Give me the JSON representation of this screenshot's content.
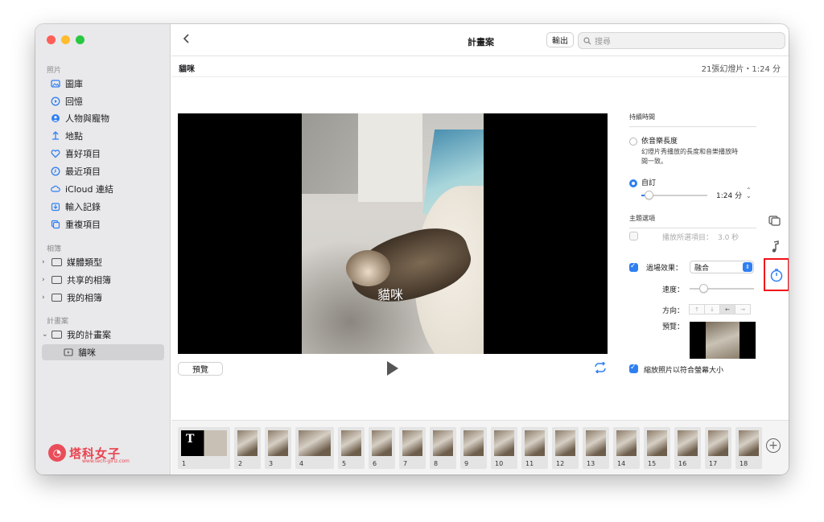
{
  "window": {
    "traffic_colors": [
      "#fe5f57",
      "#febc2e",
      "#28c840"
    ]
  },
  "sidebar": {
    "sections": [
      {
        "title": "照片",
        "items": [
          {
            "label": "圖庫",
            "icon": "photo-library-icon"
          },
          {
            "label": "回憶",
            "icon": "memories-icon"
          },
          {
            "label": "人物與寵物",
            "icon": "people-icon"
          },
          {
            "label": "地點",
            "icon": "places-icon"
          },
          {
            "label": "喜好項目",
            "icon": "heart-icon"
          },
          {
            "label": "最近項目",
            "icon": "clock-icon"
          },
          {
            "label": "iCloud 連結",
            "icon": "cloud-link-icon"
          },
          {
            "label": "輸入記錄",
            "icon": "import-icon"
          },
          {
            "label": "重複項目",
            "icon": "duplicates-icon"
          }
        ]
      },
      {
        "title": "相簿",
        "items": [
          {
            "label": "媒體類型"
          },
          {
            "label": "共享的相簿"
          },
          {
            "label": "我的相簿"
          }
        ]
      },
      {
        "title": "計畫案",
        "items": [
          {
            "label": "我的計畫案"
          },
          {
            "label": "貓咪"
          }
        ]
      }
    ],
    "logo": {
      "text": "塔科女子",
      "sub": "www.tech-girlz.com"
    }
  },
  "toolbar": {
    "title": "計畫案",
    "export_label": "輸出",
    "search_placeholder": "搜尋"
  },
  "project": {
    "name": "貓咪",
    "info": "21張幻燈片・1:24 分"
  },
  "viewer": {
    "caption": "貓咪",
    "preview_label": "預覽"
  },
  "inspector": {
    "duration_header": "持續時間",
    "match_music_label": "依音樂長度",
    "match_music_desc_1": "幻燈片秀播放的長度和音樂播放時",
    "match_music_desc_2": "間一致。",
    "custom_label": "自訂",
    "custom_value": "1:24 分",
    "theme_header": "主題選項",
    "play_selected_label": "播放所選項目：",
    "play_selected_value": "3.0 秒",
    "transition_label": "過場效果：",
    "transition_value": "融合",
    "speed_label": "速度：",
    "direction_label": "方向：",
    "directions": [
      "↑",
      "↓",
      "←",
      "→"
    ],
    "preview_label": "預覽：",
    "scale_label": "縮放照片以符合螢幕大小"
  },
  "filmstrip": {
    "clips": [
      "1",
      "2",
      "3",
      "4",
      "5",
      "6",
      "7",
      "8",
      "9",
      "10",
      "11",
      "12",
      "13",
      "14",
      "15",
      "16",
      "17",
      "18"
    ],
    "title_slide_glyph": "T"
  },
  "colors": {
    "accent": "#2f7ff3",
    "highlight": "#f2101a",
    "logo": "#e9434f"
  }
}
